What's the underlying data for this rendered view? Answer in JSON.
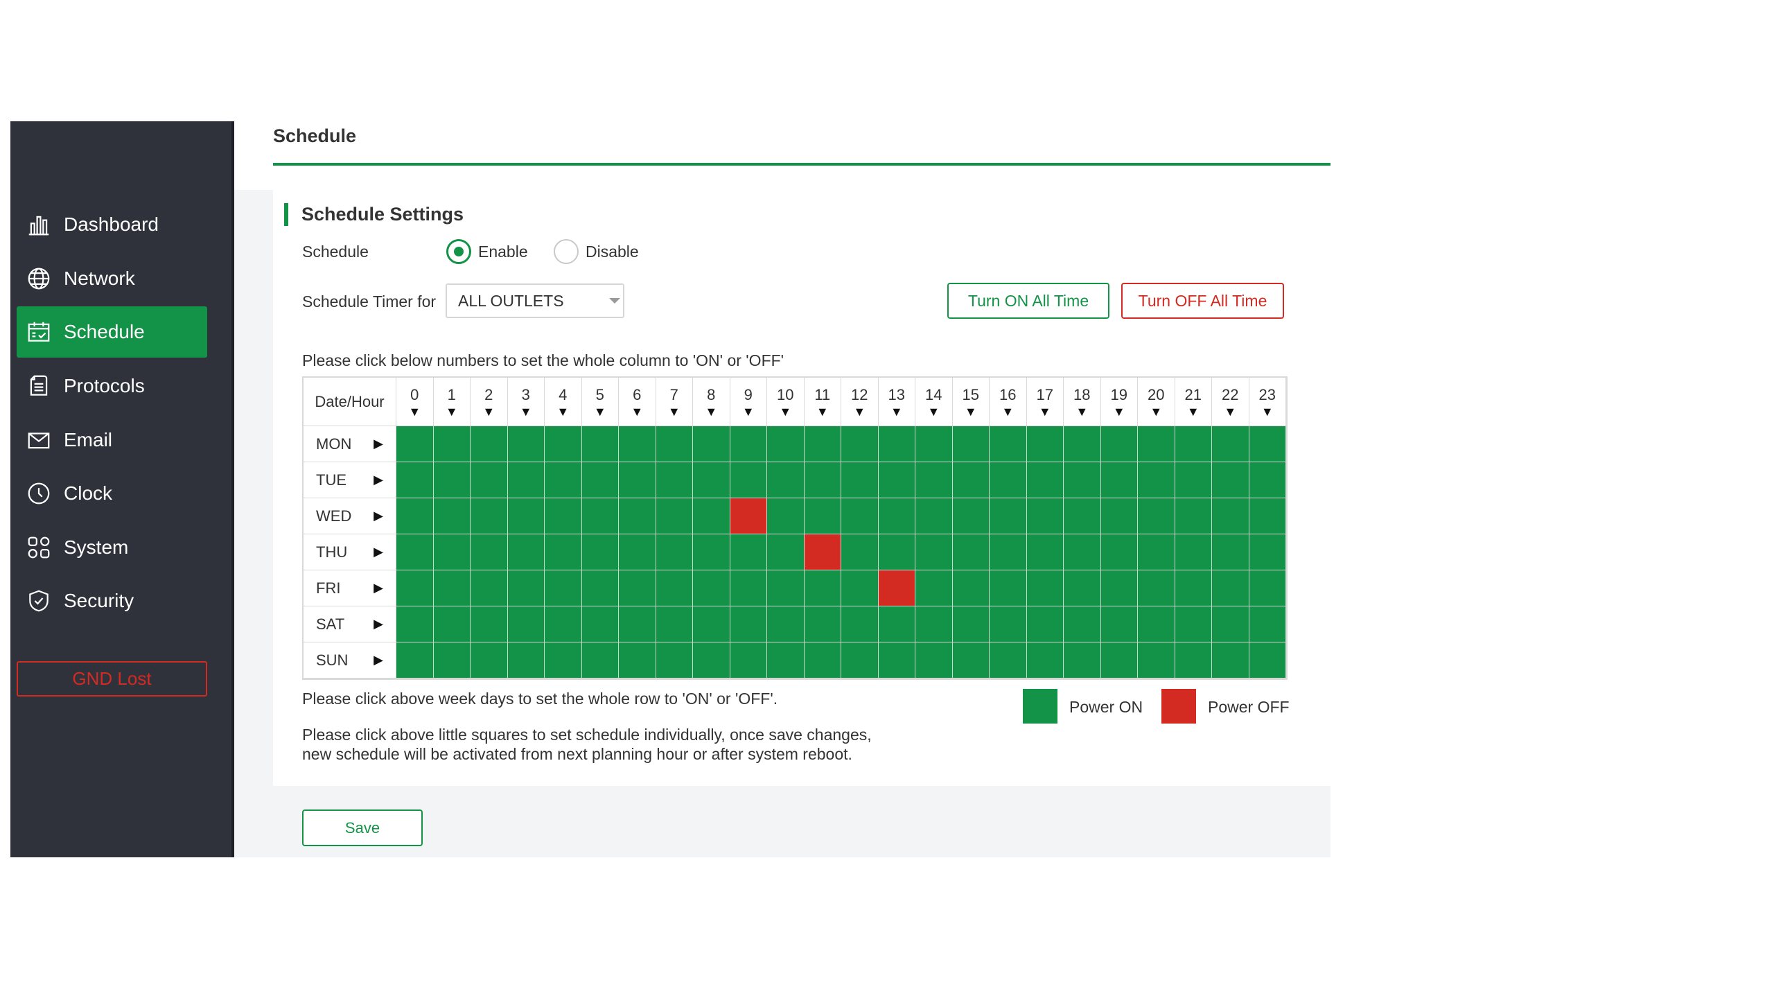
{
  "nav": {
    "items": [
      {
        "label": "Dashboard",
        "icon": "bar-chart-icon"
      },
      {
        "label": "Network",
        "icon": "globe-icon"
      },
      {
        "label": "Schedule",
        "icon": "calendar-check-icon",
        "active": true
      },
      {
        "label": "Protocols",
        "icon": "document-icon"
      },
      {
        "label": "Email",
        "icon": "envelope-icon"
      },
      {
        "label": "Clock",
        "icon": "clock-icon"
      },
      {
        "label": "System",
        "icon": "grid-icon"
      },
      {
        "label": "Security",
        "icon": "shield-check-icon"
      }
    ],
    "status_label": "GND Lost"
  },
  "page": {
    "title": "Schedule",
    "section_title": "Schedule Settings",
    "schedule_label": "Schedule",
    "enable_label": "Enable",
    "disable_label": "Disable",
    "schedule_enabled": true,
    "timer_for_label": "Schedule Timer for",
    "timer_for_value": "ALL OUTLETS",
    "turn_on_all": "Turn ON All Time",
    "turn_off_all": "Turn OFF All Time",
    "column_hint": "Please click below numbers to set the whole column to 'ON' or 'OFF'",
    "row_hint": "Please click above week days to set the whole row to 'ON' or 'OFF'.",
    "cell_hint_line1": "Please click above little squares to set schedule individually, once save changes,",
    "cell_hint_line2": "new schedule will be activated from next planning hour or after system reboot.",
    "legend_on": "Power ON",
    "legend_off": "Power OFF",
    "save_label": "Save"
  },
  "schedule": {
    "corner_label": "Date/Hour",
    "hours": [
      "0",
      "1",
      "2",
      "3",
      "4",
      "5",
      "6",
      "7",
      "8",
      "9",
      "10",
      "11",
      "12",
      "13",
      "14",
      "15",
      "16",
      "17",
      "18",
      "19",
      "20",
      "21",
      "22",
      "23"
    ],
    "days": [
      "MON",
      "TUE",
      "WED",
      "THU",
      "FRI",
      "SAT",
      "SUN"
    ],
    "off_cells": [
      {
        "day": "WED",
        "hour": 9
      },
      {
        "day": "THU",
        "hour": 11
      },
      {
        "day": "FRI",
        "hour": 13
      }
    ]
  },
  "colors": {
    "on": "#139347",
    "off": "#d32a22",
    "sidebar": "#2f323b"
  }
}
